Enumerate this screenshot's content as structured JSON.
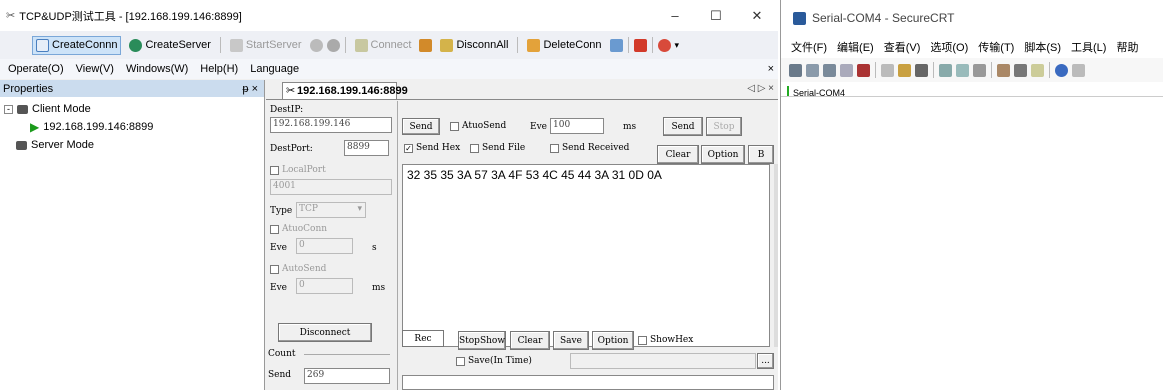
{
  "tcp_window": {
    "title": "TCP&UDP测试工具 - [192.168.199.146:8899]",
    "toolbar": {
      "create_conn": "CreateConnn",
      "create_server": "CreateServer",
      "start_server": "StartServer",
      "connect": "Connect",
      "disconn_all": "DisconnAll",
      "delete_conn": "DeleteConn"
    },
    "menu": {
      "operate": "Operate(O)",
      "view": "View(V)",
      "windows": "Windows(W)",
      "help": "Help(H)",
      "language": "Language"
    },
    "properties": {
      "header": "Properties",
      "pin": "ᵽ ×",
      "client_mode": "Client Mode",
      "client_conn": "192.168.199.146:8899",
      "server_mode": "Server Mode"
    },
    "tab": {
      "label": "192.168.199.146:8899",
      "nav": "◁ ▷ ×"
    },
    "left": {
      "dest_ip_label": "DestIP:",
      "dest_ip": "192.168.199.146",
      "dest_port_label": "DestPort:",
      "dest_port": "8899",
      "local_port_label": "LocalPort",
      "local_port": "4001",
      "type_label": "Type",
      "type_value": "TCP",
      "atuo_conn_label": "AtuoConn",
      "eve1_label": "Eve",
      "eve1_value": "0",
      "eve1_unit": "s",
      "auto_send_label": "AutoSend",
      "eve2_label": "Eve",
      "eve2_value": "0",
      "eve2_unit": "ms",
      "disconnect": "Disconnect",
      "count_label": "Count",
      "send_label": "Send",
      "send_count": "269"
    },
    "send_panel": {
      "send_group": "Send",
      "atuo_send": "AtuoSend",
      "eve_label": "Eve",
      "eve_value": "100",
      "eve_unit": "ms",
      "send_btn": "Send",
      "stop_btn": "Stop",
      "send_hex": "Send Hex",
      "send_file": "Send File",
      "send_received": "Send Received",
      "clear_btn": "Clear",
      "option_btn": "Option",
      "b_btn": "B",
      "content": "32 35 35 3A 57 3A 4F 53 4C 45 44 3A 31 0D 0A"
    },
    "rec_panel": {
      "rec_group": "Rec",
      "stop_show": "StopShow",
      "clear": "Clear",
      "save": "Save",
      "option": "Option",
      "show_hex": "ShowHex",
      "save_in_time": "Save(In Time)",
      "browse": "..."
    }
  },
  "crt_window": {
    "title": "Serial-COM4 - SecureCRT",
    "menu": [
      "文件(F)",
      "编辑(E)",
      "查看(V)",
      "选项(O)",
      "传输(T)",
      "脚本(S)",
      "工具(L)",
      "帮助"
    ],
    "tab": "Serial-COM4"
  }
}
